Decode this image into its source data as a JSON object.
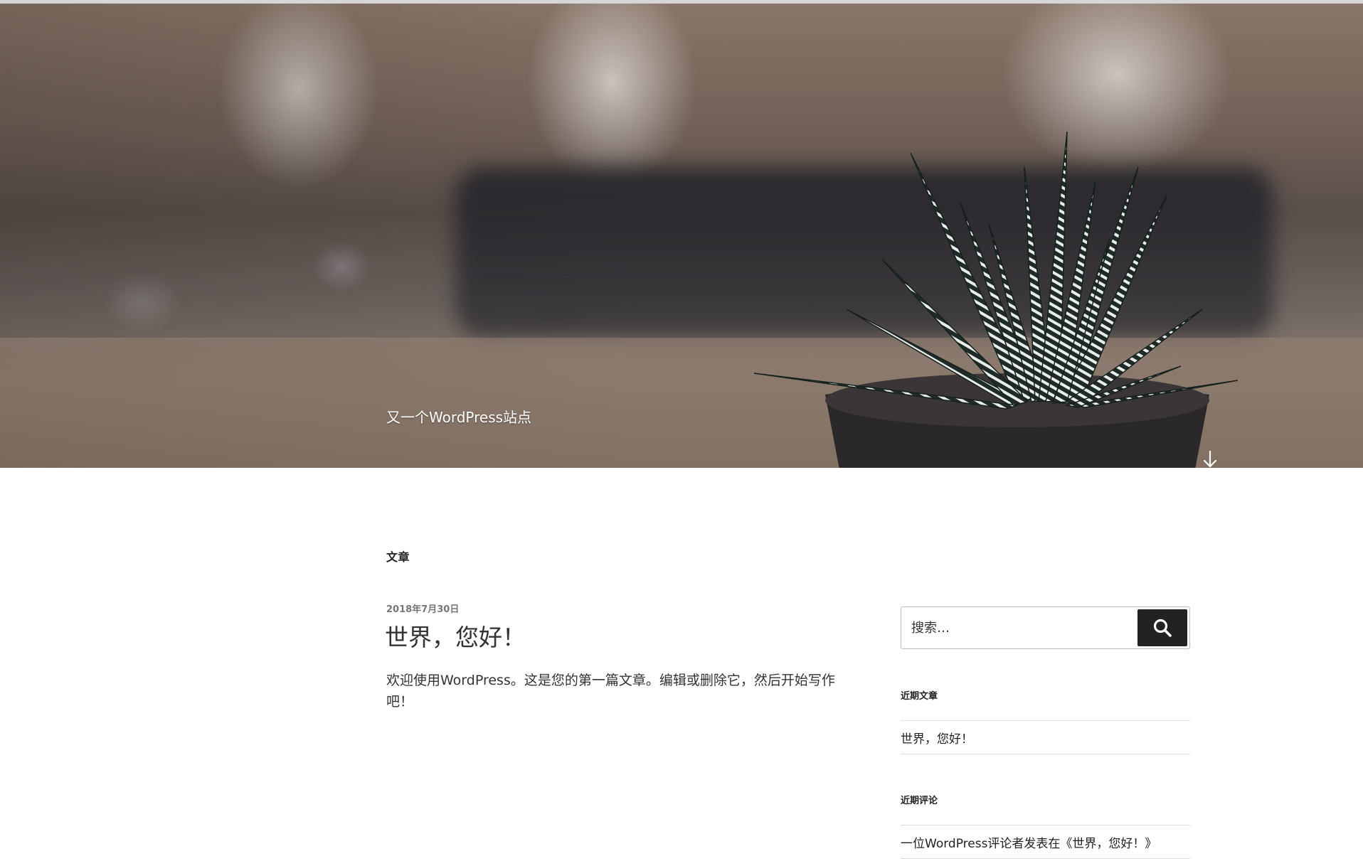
{
  "header": {
    "site_description": "又一个WordPress站点",
    "scroll_icon": "arrow-down-icon"
  },
  "main": {
    "page_title": "文章",
    "post": {
      "date": "2018年7月30日",
      "title": "世界，您好！",
      "excerpt": "欢迎使用WordPress。这是您的第一篇文章。编辑或删除它，然后开始写作吧！"
    }
  },
  "sidebar": {
    "search": {
      "placeholder": "搜索…",
      "icon": "search-icon"
    },
    "recent_posts": {
      "title": "近期文章",
      "items": [
        "世界，您好！"
      ]
    },
    "recent_comments": {
      "title": "近期评论",
      "items": [
        "一位WordPress评论者发表在《世界，您好！》"
      ]
    }
  },
  "colors": {
    "text": "#222222",
    "muted": "#767676",
    "search_button_bg": "#222222",
    "divider": "#dddddd"
  }
}
